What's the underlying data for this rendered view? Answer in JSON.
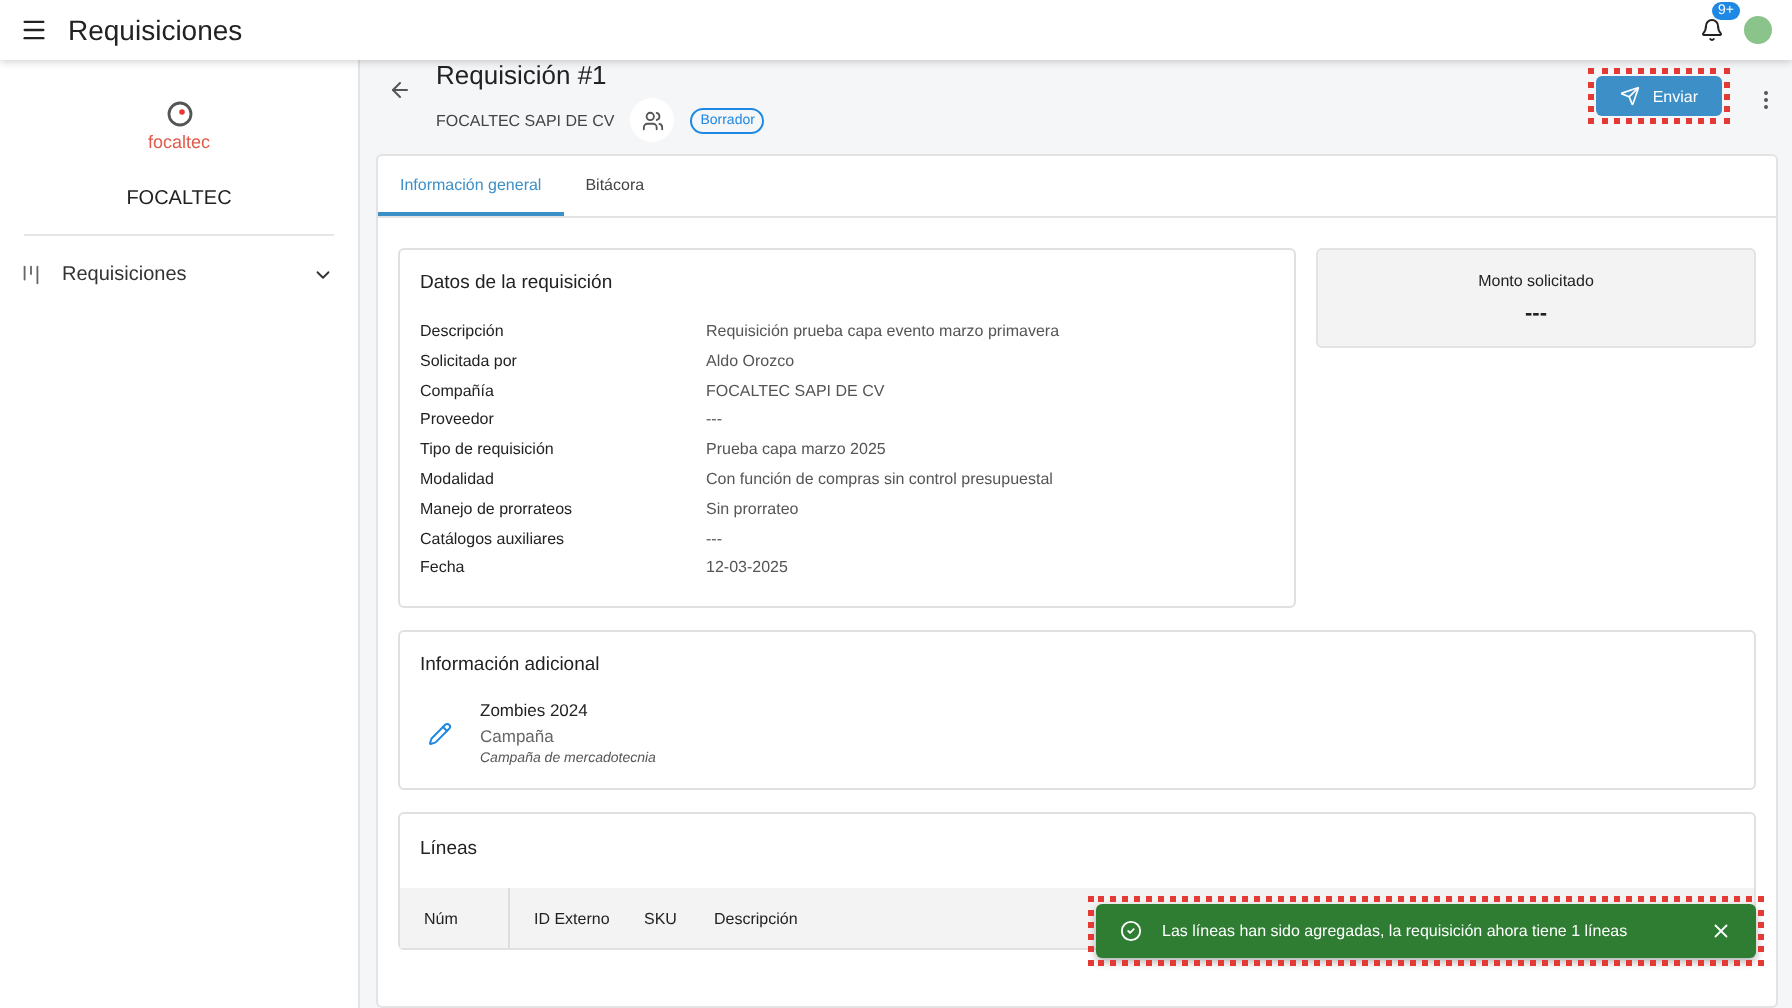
{
  "app_bar": {
    "title": "Requisiciones",
    "notification_count": "9+"
  },
  "sidebar": {
    "logo_text": "focaltec",
    "company": "FOCALTEC",
    "items": [
      {
        "label": "Requisiciones",
        "expanded": false
      }
    ]
  },
  "header": {
    "title": "Requisición #1",
    "company": "FOCALTEC SAPI DE CV",
    "status": "Borrador",
    "send_button": "Enviar"
  },
  "tabs": [
    {
      "label": "Información general",
      "selected": true
    },
    {
      "label": "Bitácora",
      "selected": false
    }
  ],
  "details": {
    "title": "Datos de la requisición",
    "rows": [
      {
        "label": "Descripción",
        "value": "Requisición prueba capa evento marzo primavera"
      },
      {
        "label": "Solicitada por",
        "value": "Aldo Orozco"
      },
      {
        "label": "Compañía",
        "value": "FOCALTEC SAPI DE CV"
      },
      {
        "label": "Proveedor",
        "value": "---"
      },
      {
        "label": "Tipo de requisición",
        "value": "Prueba capa marzo 2025"
      },
      {
        "label": "Modalidad",
        "value": "Con función de compras sin control presupuestal"
      },
      {
        "label": "Manejo de prorrateos",
        "value": "Sin prorrateo"
      },
      {
        "label": "Catálogos auxiliares",
        "value": "---"
      },
      {
        "label": "Fecha",
        "value": "12-03-2025"
      }
    ]
  },
  "amount": {
    "label": "Monto solicitado",
    "value": "---"
  },
  "additional": {
    "title": "Información adicional",
    "name": "Zombies 2024",
    "type": "Campaña",
    "description": "Campaña de mercadotecnia"
  },
  "lines": {
    "title": "Líneas",
    "columns": [
      "Núm",
      "ID Externo",
      "SKU",
      "Descripción"
    ]
  },
  "toast": {
    "message": "Las líneas han sido agregadas, la requisición ahora tiene 1 líneas"
  }
}
